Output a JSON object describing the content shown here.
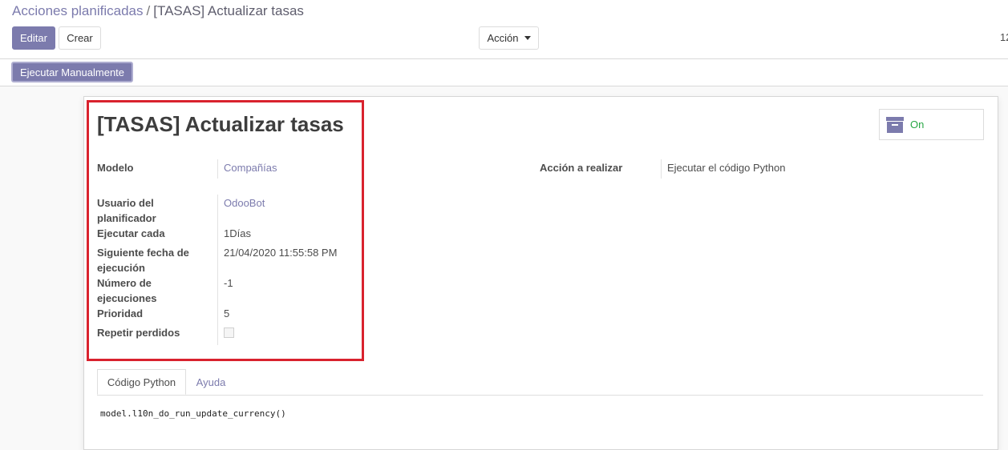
{
  "breadcrumb": {
    "parent": "Acciones planificadas",
    "separator": "/",
    "current": "[TASAS] Actualizar tasas"
  },
  "toolbar": {
    "edit_label": "Editar",
    "create_label": "Crear",
    "action_label": "Acción",
    "pager_text": "12"
  },
  "statusbar": {
    "run_manually_label": "Ejecutar Manualmente"
  },
  "record": {
    "title": "[TASAS] Actualizar tasas",
    "active_label": "On",
    "fields": {
      "model_label": "Modelo",
      "model_value": "Compañías",
      "user_label_line1": "Usuario del",
      "user_label_line2": "planificador",
      "user_value": "OdooBot",
      "interval_label": "Ejecutar cada",
      "interval_value": "1Días",
      "nextcall_label_line1": "Siguiente fecha de",
      "nextcall_label_line2": "ejecución",
      "nextcall_value": "21/04/2020 11:55:58 PM",
      "numbercall_label_line1": "Número de",
      "numbercall_label_line2": "ejecuciones",
      "numbercall_value": "-1",
      "priority_label": "Prioridad",
      "priority_value": "5",
      "doall_label": "Repetir perdidos",
      "doall_checked": false,
      "action_label": "Acción a realizar",
      "action_value": "Ejecutar el código Python"
    }
  },
  "tabs": [
    {
      "label": "Código Python",
      "active": true
    },
    {
      "label": "Ayuda",
      "active": false
    }
  ],
  "code": "model.l10n_do_run_update_currency()",
  "icons": {
    "archive": "archive-icon",
    "caret": "caret-down-icon"
  },
  "colors": {
    "primary": "#7c7bad",
    "highlight_border": "#d9222e",
    "active_green": "#28a745"
  }
}
